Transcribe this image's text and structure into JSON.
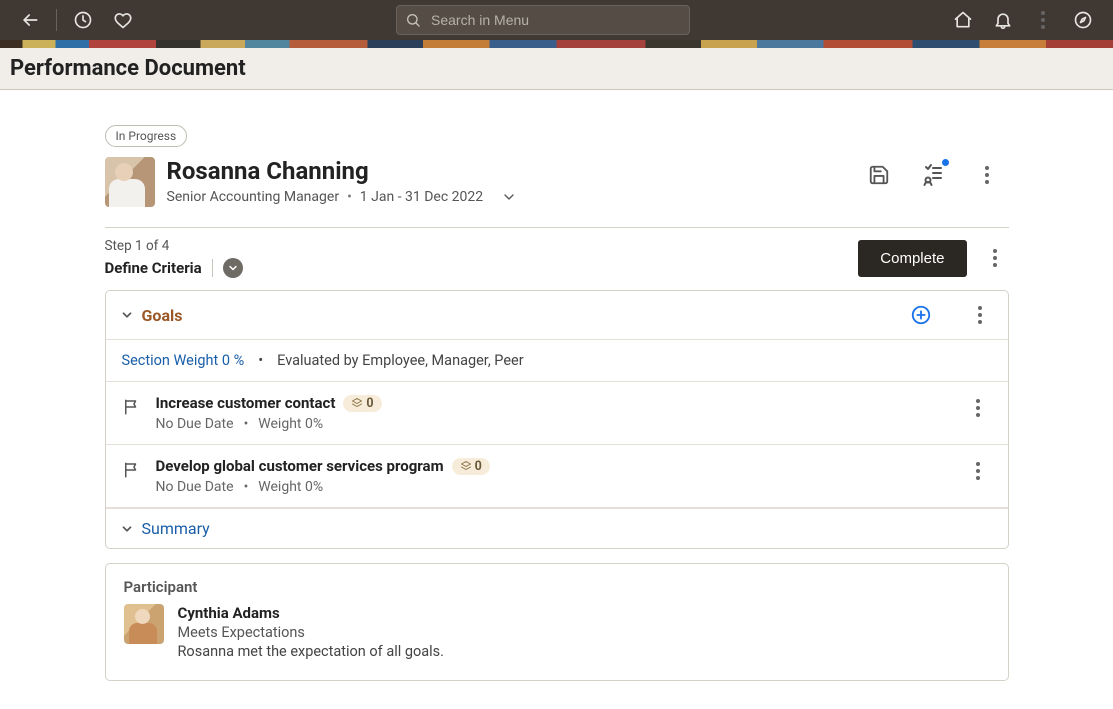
{
  "topbar": {
    "search_placeholder": "Search in Menu"
  },
  "page": {
    "title": "Performance Document"
  },
  "status": "In Progress",
  "profile": {
    "name": "Rosanna Channing",
    "role": "Senior Accounting Manager",
    "period": "1 Jan - 31 Dec 2022"
  },
  "step": {
    "progress_text": "Step 1 of 4",
    "label": "Define Criteria",
    "complete_label": "Complete"
  },
  "goals": {
    "title": "Goals",
    "section_weight_label": "Section Weight 0 %",
    "evaluated_by": "Evaluated by Employee, Manager, Peer",
    "items": [
      {
        "title": "Increase customer contact",
        "badge": "0",
        "due": "No Due Date",
        "weight": "Weight 0%"
      },
      {
        "title": "Develop global customer services program",
        "badge": "0",
        "due": "No Due Date",
        "weight": "Weight 0%"
      }
    ],
    "summary_label": "Summary"
  },
  "participant": {
    "section_title": "Participant",
    "name": "Cynthia Adams",
    "rating": "Meets Expectations",
    "comment": "Rosanna met the expectation of all goals."
  }
}
